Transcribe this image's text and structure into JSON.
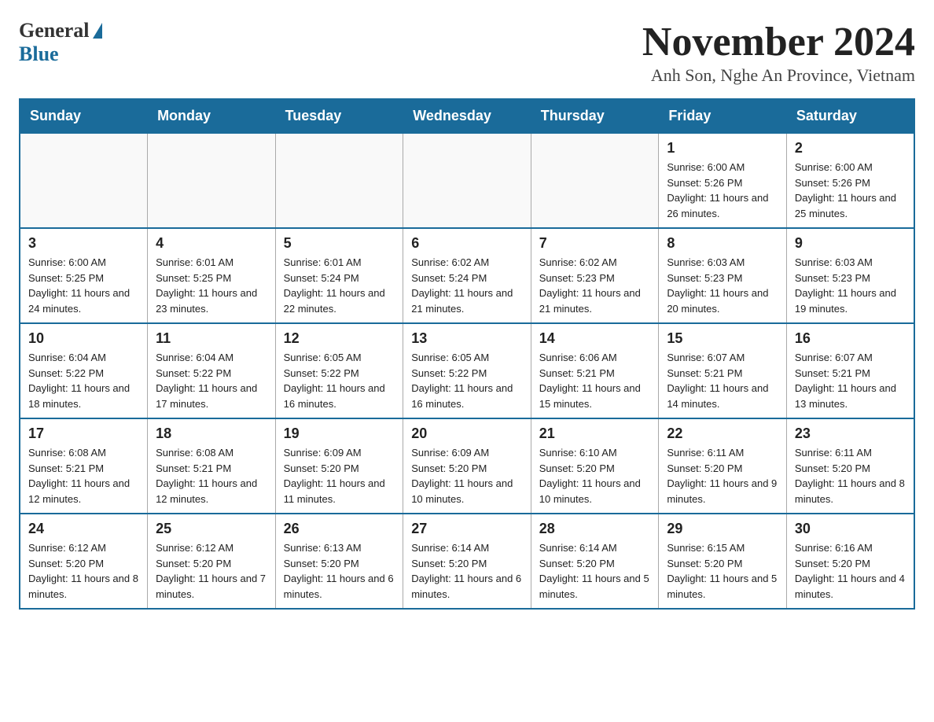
{
  "logo": {
    "general": "General",
    "blue": "Blue"
  },
  "title": {
    "month": "November 2024",
    "location": "Anh Son, Nghe An Province, Vietnam"
  },
  "days_of_week": [
    "Sunday",
    "Monday",
    "Tuesday",
    "Wednesday",
    "Thursday",
    "Friday",
    "Saturday"
  ],
  "weeks": [
    [
      {
        "day": "",
        "info": ""
      },
      {
        "day": "",
        "info": ""
      },
      {
        "day": "",
        "info": ""
      },
      {
        "day": "",
        "info": ""
      },
      {
        "day": "",
        "info": ""
      },
      {
        "day": "1",
        "info": "Sunrise: 6:00 AM\nSunset: 5:26 PM\nDaylight: 11 hours and 26 minutes."
      },
      {
        "day": "2",
        "info": "Sunrise: 6:00 AM\nSunset: 5:26 PM\nDaylight: 11 hours and 25 minutes."
      }
    ],
    [
      {
        "day": "3",
        "info": "Sunrise: 6:00 AM\nSunset: 5:25 PM\nDaylight: 11 hours and 24 minutes."
      },
      {
        "day": "4",
        "info": "Sunrise: 6:01 AM\nSunset: 5:25 PM\nDaylight: 11 hours and 23 minutes."
      },
      {
        "day": "5",
        "info": "Sunrise: 6:01 AM\nSunset: 5:24 PM\nDaylight: 11 hours and 22 minutes."
      },
      {
        "day": "6",
        "info": "Sunrise: 6:02 AM\nSunset: 5:24 PM\nDaylight: 11 hours and 21 minutes."
      },
      {
        "day": "7",
        "info": "Sunrise: 6:02 AM\nSunset: 5:23 PM\nDaylight: 11 hours and 21 minutes."
      },
      {
        "day": "8",
        "info": "Sunrise: 6:03 AM\nSunset: 5:23 PM\nDaylight: 11 hours and 20 minutes."
      },
      {
        "day": "9",
        "info": "Sunrise: 6:03 AM\nSunset: 5:23 PM\nDaylight: 11 hours and 19 minutes."
      }
    ],
    [
      {
        "day": "10",
        "info": "Sunrise: 6:04 AM\nSunset: 5:22 PM\nDaylight: 11 hours and 18 minutes."
      },
      {
        "day": "11",
        "info": "Sunrise: 6:04 AM\nSunset: 5:22 PM\nDaylight: 11 hours and 17 minutes."
      },
      {
        "day": "12",
        "info": "Sunrise: 6:05 AM\nSunset: 5:22 PM\nDaylight: 11 hours and 16 minutes."
      },
      {
        "day": "13",
        "info": "Sunrise: 6:05 AM\nSunset: 5:22 PM\nDaylight: 11 hours and 16 minutes."
      },
      {
        "day": "14",
        "info": "Sunrise: 6:06 AM\nSunset: 5:21 PM\nDaylight: 11 hours and 15 minutes."
      },
      {
        "day": "15",
        "info": "Sunrise: 6:07 AM\nSunset: 5:21 PM\nDaylight: 11 hours and 14 minutes."
      },
      {
        "day": "16",
        "info": "Sunrise: 6:07 AM\nSunset: 5:21 PM\nDaylight: 11 hours and 13 minutes."
      }
    ],
    [
      {
        "day": "17",
        "info": "Sunrise: 6:08 AM\nSunset: 5:21 PM\nDaylight: 11 hours and 12 minutes."
      },
      {
        "day": "18",
        "info": "Sunrise: 6:08 AM\nSunset: 5:21 PM\nDaylight: 11 hours and 12 minutes."
      },
      {
        "day": "19",
        "info": "Sunrise: 6:09 AM\nSunset: 5:20 PM\nDaylight: 11 hours and 11 minutes."
      },
      {
        "day": "20",
        "info": "Sunrise: 6:09 AM\nSunset: 5:20 PM\nDaylight: 11 hours and 10 minutes."
      },
      {
        "day": "21",
        "info": "Sunrise: 6:10 AM\nSunset: 5:20 PM\nDaylight: 11 hours and 10 minutes."
      },
      {
        "day": "22",
        "info": "Sunrise: 6:11 AM\nSunset: 5:20 PM\nDaylight: 11 hours and 9 minutes."
      },
      {
        "day": "23",
        "info": "Sunrise: 6:11 AM\nSunset: 5:20 PM\nDaylight: 11 hours and 8 minutes."
      }
    ],
    [
      {
        "day": "24",
        "info": "Sunrise: 6:12 AM\nSunset: 5:20 PM\nDaylight: 11 hours and 8 minutes."
      },
      {
        "day": "25",
        "info": "Sunrise: 6:12 AM\nSunset: 5:20 PM\nDaylight: 11 hours and 7 minutes."
      },
      {
        "day": "26",
        "info": "Sunrise: 6:13 AM\nSunset: 5:20 PM\nDaylight: 11 hours and 6 minutes."
      },
      {
        "day": "27",
        "info": "Sunrise: 6:14 AM\nSunset: 5:20 PM\nDaylight: 11 hours and 6 minutes."
      },
      {
        "day": "28",
        "info": "Sunrise: 6:14 AM\nSunset: 5:20 PM\nDaylight: 11 hours and 5 minutes."
      },
      {
        "day": "29",
        "info": "Sunrise: 6:15 AM\nSunset: 5:20 PM\nDaylight: 11 hours and 5 minutes."
      },
      {
        "day": "30",
        "info": "Sunrise: 6:16 AM\nSunset: 5:20 PM\nDaylight: 11 hours and 4 minutes."
      }
    ]
  ]
}
